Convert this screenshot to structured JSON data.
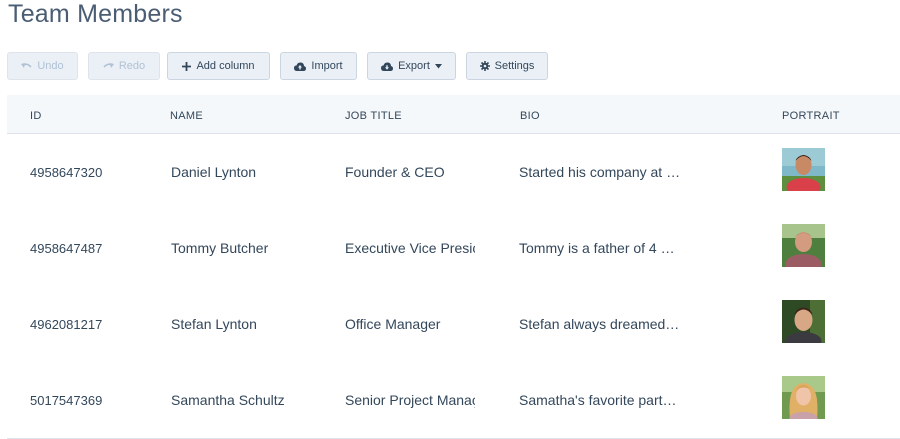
{
  "page": {
    "title": "Team Members"
  },
  "toolbar": {
    "undo": "Undo",
    "redo": "Redo",
    "add_column": "Add column",
    "import": "Import",
    "export": "Export",
    "settings": "Settings"
  },
  "table": {
    "headers": {
      "id": "ID",
      "name": "NAME",
      "job_title": "JOB TITLE",
      "bio": "BIO",
      "portrait": "PORTRAIT"
    },
    "rows": [
      {
        "id": "4958647320",
        "name": "Daniel Lynton",
        "job_title": "Founder & CEO",
        "bio": "Started his company at …"
      },
      {
        "id": "4958647487",
        "name": "Tommy Butcher",
        "job_title": "Executive Vice Presic",
        "bio": "Tommy is a father of 4 …"
      },
      {
        "id": "4962081217",
        "name": "Stefan Lynton",
        "job_title": "Office Manager",
        "bio": "Stefan always dreamed…"
      },
      {
        "id": "5017547369",
        "name": "Samantha Schultz",
        "job_title": "Senior Project Manaç",
        "bio": "Samatha's favorite part…"
      }
    ]
  }
}
